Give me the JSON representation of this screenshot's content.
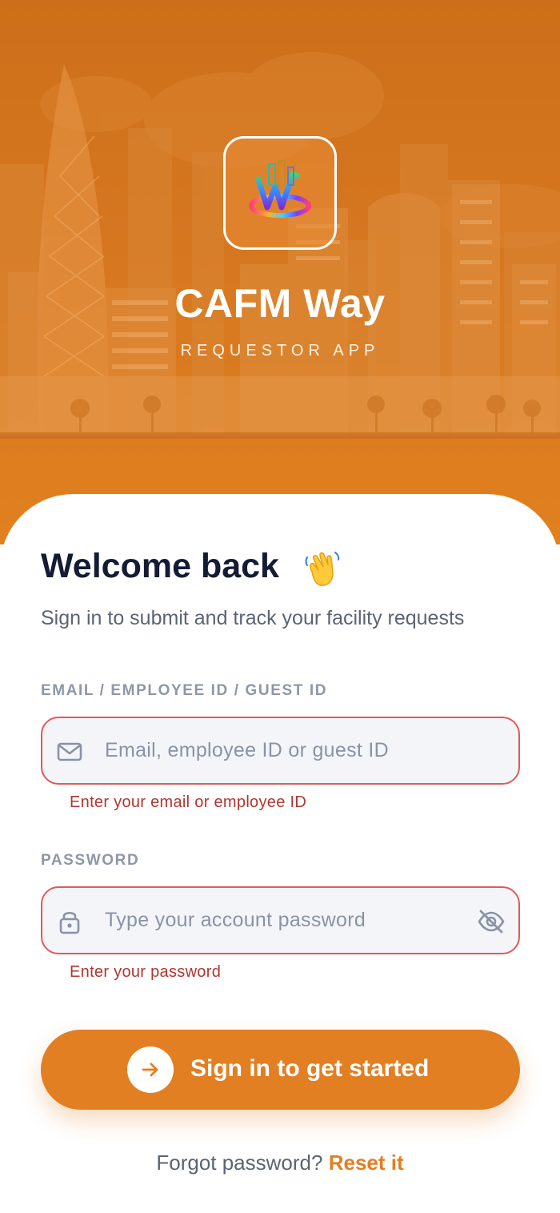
{
  "app": {
    "title": "CAFM Way",
    "subtitle": "REQUESTOR APP",
    "logo_icon": "cafm-way-logo-icon"
  },
  "login": {
    "heading": "Welcome back",
    "heading_icon": "waving-hand-icon",
    "subheading": "Sign in to submit and track your facility requests",
    "email": {
      "label": "EMAIL / EMPLOYEE ID / GUEST ID",
      "value": "",
      "placeholder": "Email, employee ID or guest ID",
      "icon": "mail-icon",
      "error": "Enter your email or employee ID"
    },
    "password": {
      "label": "PASSWORD",
      "value": "",
      "placeholder": "Type your account password",
      "icon": "lock-icon",
      "toggle_icon": "eye-off-icon",
      "error": "Enter your password"
    },
    "submit_label": "Sign in to get started",
    "submit_icon": "arrow-right-icon",
    "forgot_text": "Forgot password?",
    "reset_link": "Reset it"
  },
  "colors": {
    "brand_orange": "#e27f22",
    "hero_top": "#cd6f1a",
    "error_red": "#e05a5a",
    "heading_navy": "#141b34"
  }
}
